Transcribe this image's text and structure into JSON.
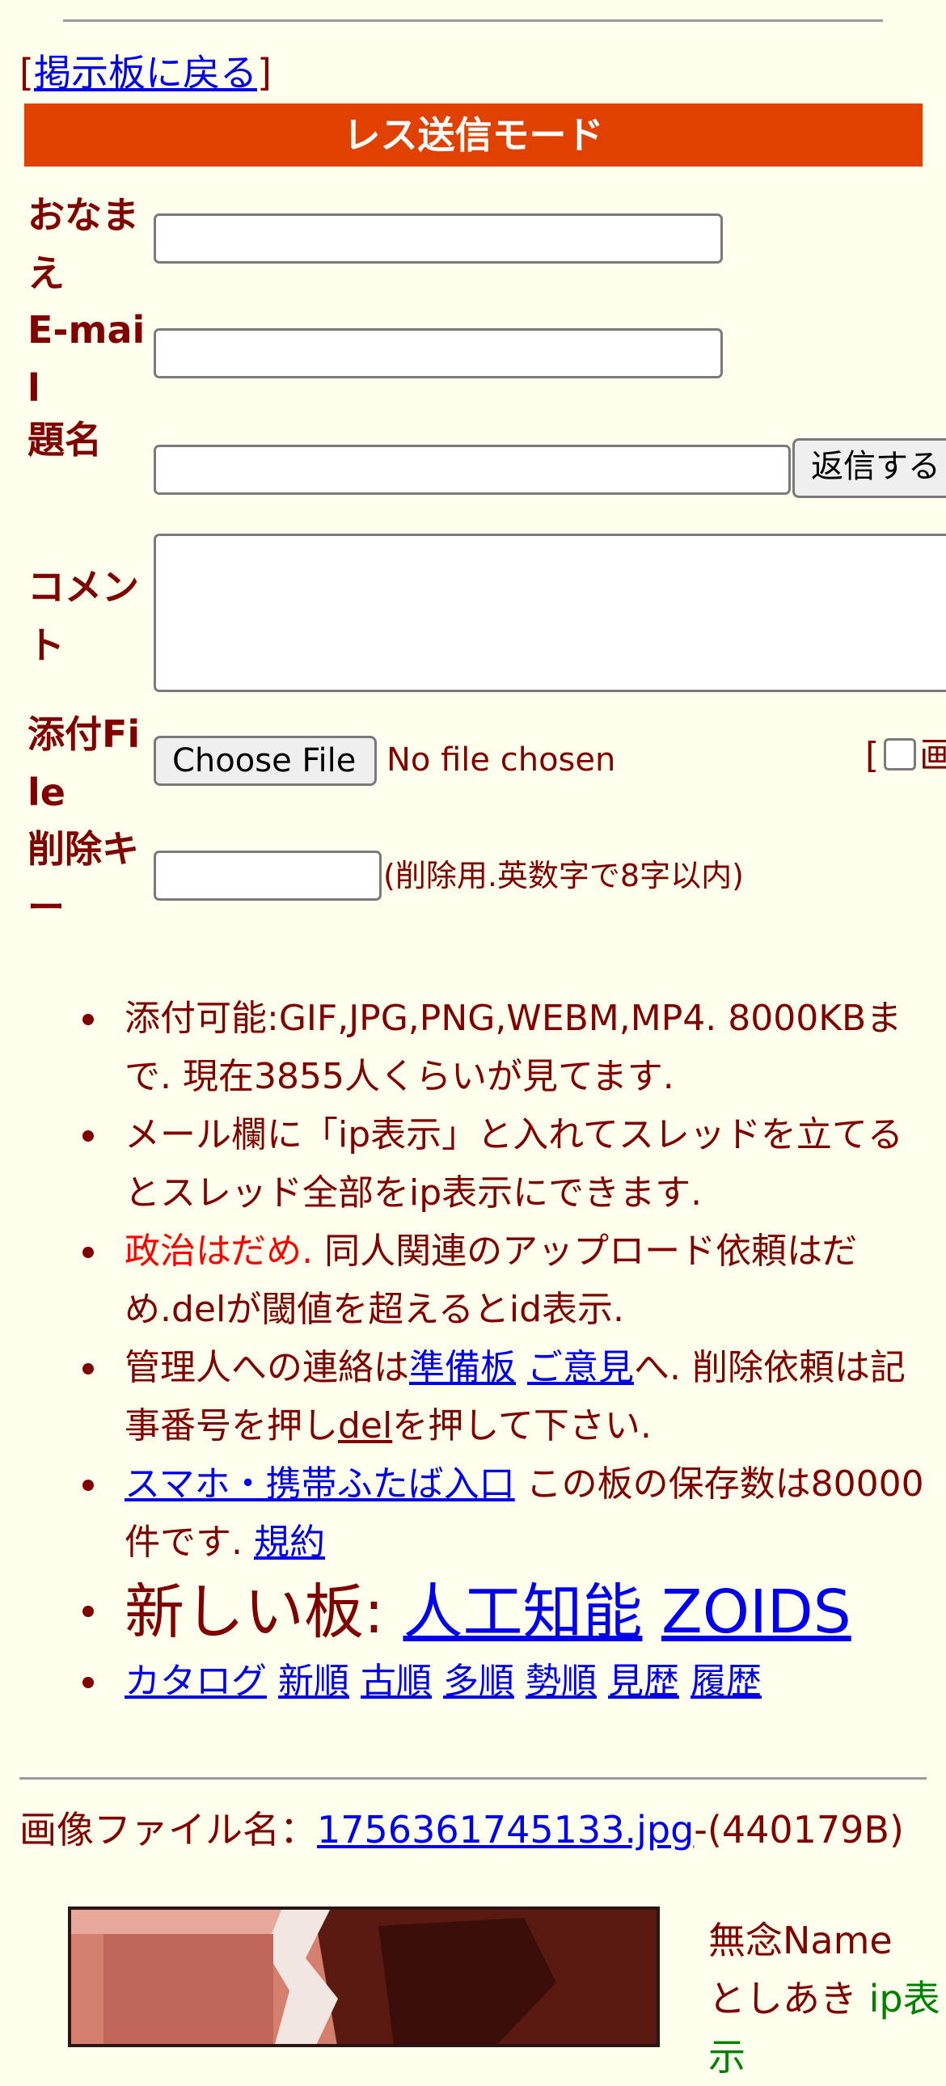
{
  "header": {
    "back_open": "[",
    "back_link": "掲示板に戻る",
    "back_close": "]"
  },
  "form": {
    "banner": "レス送信モード",
    "name_label": "おなまえ",
    "email_label": "E-mail",
    "subject_label": "題名",
    "submit_label": "返信する",
    "comment_label": "コメント",
    "file_label": "添付File",
    "choose_file_label": "Choose File",
    "no_file_text": "No file chosen",
    "image_option_prefix": "[",
    "image_option_text": "画",
    "delkey_label": "削除キー",
    "delkey_note": "(削除用.英数字で8字以内)"
  },
  "notes": {
    "n1": "添付可能:GIF,JPG,PNG,WEBM,MP4. 8000KBまで. 現在3855人くらいが見てます.",
    "n2": "メール欄に「ip表示」と入れてスレッドを立てるとスレッド全部をip表示にできます.",
    "n3_red": "政治はだめ.",
    "n3_rest": " 同人関連のアップロード依頼はだめ.delが閾値を超えるとid表示.",
    "n4_a": "管理人への連絡は",
    "n4_link1": "準備板",
    "n4_link2": "ご意見",
    "n4_b": "へ. 削除依頼は記事番号を押し",
    "n4_link3": "del",
    "n4_c": "を押して下さい.",
    "n5_link": "スマホ・携帯ふたば入口",
    "n5_text": " この板の保存数は80000件です. ",
    "n5_link2": "規約",
    "n6_prefix": "新しい板: ",
    "n6_link1": "人工知能",
    "n6_link2": "ZOIDS",
    "sort_links": [
      "カタログ",
      "新順",
      "古順",
      "多順",
      "勢順",
      "見歴",
      "履歴"
    ]
  },
  "post": {
    "file_prefix": "画像ファイル名：",
    "file_link": "1756361745133.jpg",
    "file_size": "-(440179B)",
    "name_line": "無念Name",
    "author": "としあき",
    "ip_text": "ip表示"
  },
  "colors": {
    "background": "#ffffee",
    "text": "#800000",
    "banner": "#e04000",
    "link": "#0000ee",
    "warning": "#ff0000",
    "ip": "#008000"
  }
}
